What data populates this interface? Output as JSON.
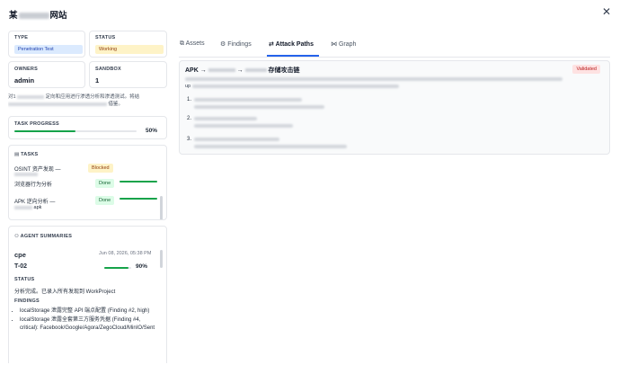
{
  "header": {
    "title_prefix": "某",
    "title_suffix": "网站"
  },
  "info": {
    "type_label": "TYPE",
    "type_value": "Penetration Test",
    "status_label": "STATUS",
    "status_value": "Working",
    "owners_label": "OWNERS",
    "owners_value": "admin",
    "sandbox_label": "SANDBOX",
    "sandbox_value": "1",
    "description_start": "对1",
    "description_mid": "定向和应用进行渗透分析和渗透测试。将结",
    "description_end": "借鉴。"
  },
  "progress": {
    "label": "TASK PROGRESS",
    "percent_text": "50%",
    "fraction": 0.5
  },
  "tasks": {
    "label": "TASKS",
    "items": [
      {
        "name": "OSINT 资产发现 —",
        "status": "Blocked"
      },
      {
        "name": "浏览器行为分析",
        "status": "Done"
      },
      {
        "name": "APK 逆向分析 —",
        "sub": "apk",
        "status": "Done"
      }
    ]
  },
  "agent": {
    "label": "AGENT SUMMARIES",
    "name": "cpe",
    "timestamp": "Jun 08, 2026, 05:38 PM",
    "id": "T-02",
    "progress_text": "90%",
    "progress_fraction": 0.9,
    "status_label": "STATUS",
    "status_text": "分析完成。已录入所有发现到 WorkProject",
    "findings_label": "FINDINGS",
    "findings": [
      "localStorage 泄露完整 API 端点配置 (Finding #2, high)",
      "localStorage 泄露全套第三方服务凭据 (Finding #4, critical): Facebook/Google/Agora/ZegoCloud/MinIO/Sent"
    ]
  },
  "tabs": [
    {
      "label": "Assets",
      "icon": "cube-icon"
    },
    {
      "label": "Findings",
      "icon": "bug-icon"
    },
    {
      "label": "Attack Paths",
      "icon": "path-icon",
      "active": true
    },
    {
      "label": "Graph",
      "icon": "graph-icon"
    }
  ],
  "attack_path": {
    "title_start": "APK →",
    "title_arrow": "→",
    "title_end": "存储攻击链",
    "badge": "Validated",
    "intro_prefix": "up",
    "steps": [
      "1.",
      "2.",
      "3."
    ]
  },
  "colors": {
    "accent": "#2563eb",
    "success": "#16a34a"
  }
}
